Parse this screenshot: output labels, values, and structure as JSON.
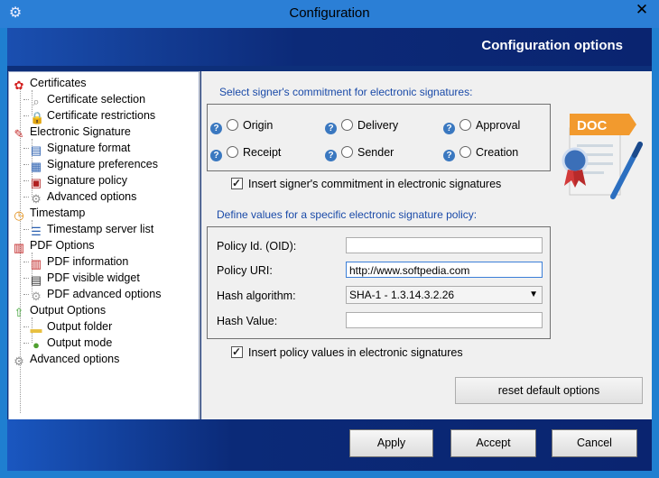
{
  "window": {
    "title": "Configuration"
  },
  "header": {
    "title": "Configuration options"
  },
  "tree": {
    "items": [
      {
        "label": "Certificates",
        "level": 0,
        "icon": "ribbon-icon",
        "color": "#d32020"
      },
      {
        "label": "Certificate selection",
        "level": 1,
        "icon": "magnifier-icon",
        "color": "#888888"
      },
      {
        "label": "Certificate restrictions",
        "level": 1,
        "icon": "lock-icon",
        "color": "#e0a000"
      },
      {
        "label": "Electronic Signature",
        "level": 0,
        "icon": "pen-icon",
        "color": "#c83030"
      },
      {
        "label": "Signature format",
        "level": 1,
        "icon": "document-icon",
        "color": "#2a5fb0"
      },
      {
        "label": "Signature preferences",
        "level": 1,
        "icon": "clipboard-icon",
        "color": "#2a5fb0"
      },
      {
        "label": "Signature policy",
        "level": 1,
        "icon": "policy-icon",
        "color": "#b02020"
      },
      {
        "label": "Advanced options",
        "level": 1,
        "icon": "gear-icon",
        "color": "#909090"
      },
      {
        "label": "Timestamp",
        "level": 0,
        "icon": "clock-icon",
        "color": "#e08a10"
      },
      {
        "label": "Timestamp server list",
        "level": 1,
        "icon": "list-icon",
        "color": "#2a5fb0"
      },
      {
        "label": "PDF Options",
        "level": 0,
        "icon": "pdf-icon",
        "color": "#c02020"
      },
      {
        "label": "PDF information",
        "level": 1,
        "icon": "pdf-info-icon",
        "color": "#c02020"
      },
      {
        "label": "PDF visible widget",
        "level": 1,
        "icon": "pdf-widget-icon",
        "color": "#303030"
      },
      {
        "label": "PDF advanced options",
        "level": 1,
        "icon": "gear-icon",
        "color": "#a0a0a0"
      },
      {
        "label": "Output Options",
        "level": 0,
        "icon": "up-arrow-icon",
        "color": "#3aa030"
      },
      {
        "label": "Output folder",
        "level": 1,
        "icon": "folder-icon",
        "color": "#e8c040"
      },
      {
        "label": "Output mode",
        "level": 1,
        "icon": "green-circle-icon",
        "color": "#50a030"
      },
      {
        "label": "Advanced options",
        "level": 0,
        "icon": "gears-icon",
        "color": "#909090"
      }
    ]
  },
  "commitment": {
    "section_label": "Select signer's commitment for electronic signatures:",
    "options": [
      "Origin",
      "Delivery",
      "Approval",
      "Receipt",
      "Sender",
      "Creation"
    ],
    "insert_label": "Insert signer's commitment in electronic signatures"
  },
  "policy": {
    "section_label": "Define values for a specific electronic signature policy:",
    "oid_label": "Policy Id. (OID):",
    "oid_value": "",
    "uri_label": "Policy URI:",
    "uri_value": "http://www.softpedia.com",
    "hash_label": "Hash algorithm:",
    "hash_value": "SHA-1  -   1.3.14.3.2.26",
    "hashvalue_label": "Hash Value:",
    "hashvalue_value": "",
    "insert_label": "Insert policy values in electronic signatures"
  },
  "buttons": {
    "reset": "reset default options",
    "apply": "Apply",
    "accept": "Accept",
    "cancel": "Cancel"
  },
  "art": {
    "doc_label": "DOC"
  },
  "colors": {
    "accent": "#1a4aa8",
    "header": "#0c2a78"
  }
}
